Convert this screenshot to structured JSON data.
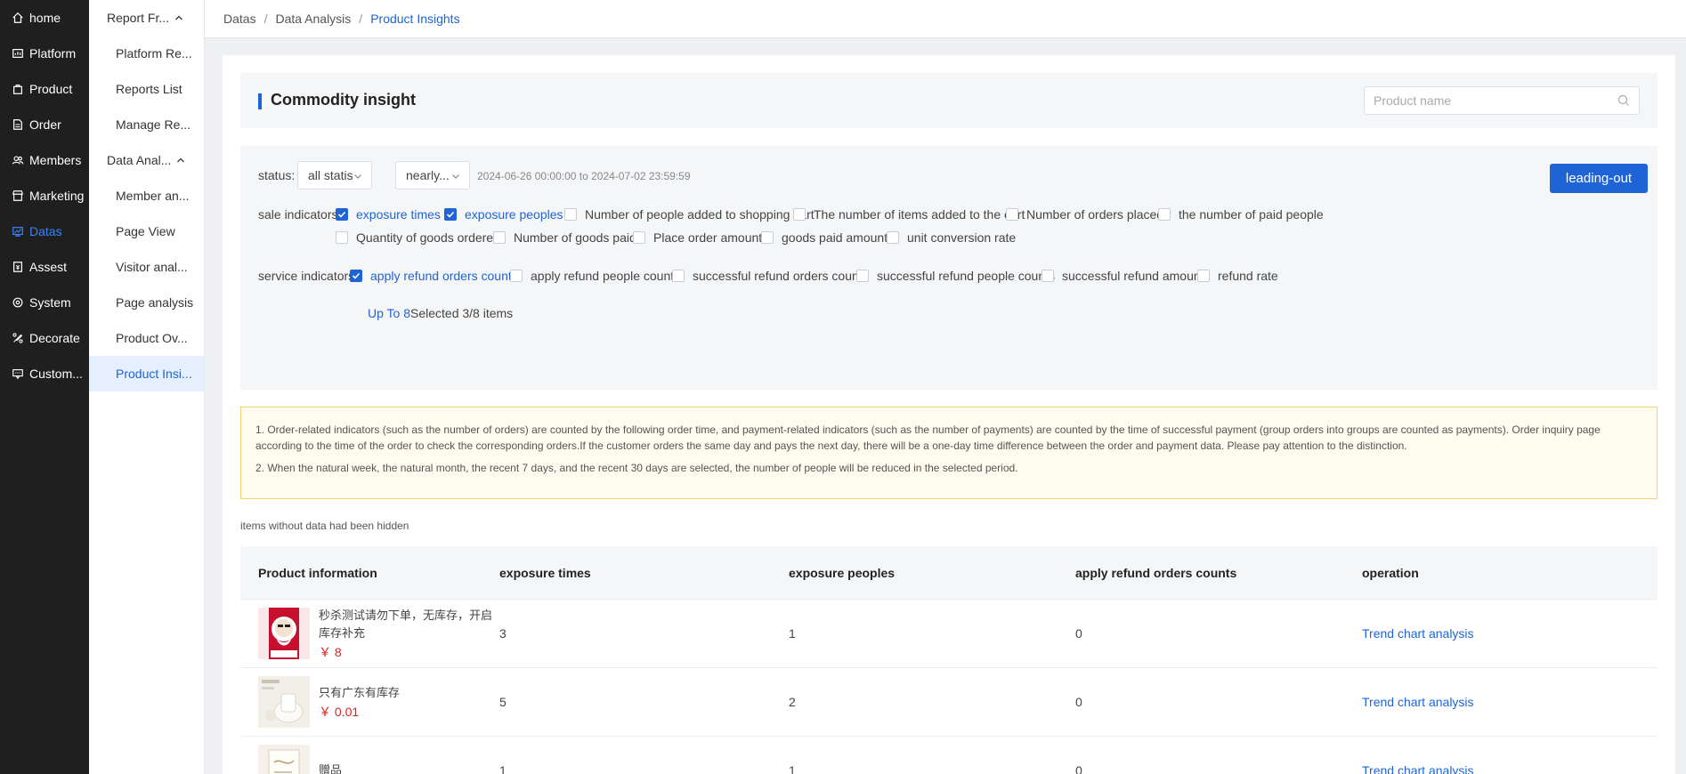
{
  "nav": {
    "items": [
      {
        "label": "home",
        "icon": "home-icon"
      },
      {
        "label": "Platform",
        "icon": "dashboard-icon"
      },
      {
        "label": "Product",
        "icon": "bag-icon"
      },
      {
        "label": "Order",
        "icon": "document-icon"
      },
      {
        "label": "Members",
        "icon": "users-icon"
      },
      {
        "label": "Marketing",
        "icon": "shop-icon"
      },
      {
        "label": "Datas",
        "icon": "chart-icon",
        "active": true
      },
      {
        "label": "Assest",
        "icon": "wallet-icon"
      },
      {
        "label": "System",
        "icon": "gear-icon"
      },
      {
        "label": "Decorate",
        "icon": "brush-icon"
      },
      {
        "label": "Custom...",
        "icon": "service-icon"
      }
    ]
  },
  "subnav": {
    "group1": "Report Fr...",
    "group1_items": [
      "Platform Re...",
      "Reports List",
      "Manage Re..."
    ],
    "group2": "Data Anal...",
    "group2_items": [
      "Member an...",
      "Page View",
      "Visitor anal...",
      "Page analysis",
      "Product Ov...",
      "Product Insi..."
    ]
  },
  "breadcrumb": [
    "Datas",
    "Data Analysis",
    "Product Insights"
  ],
  "header": {
    "title": "Commodity insight",
    "search_placeholder": "Product name"
  },
  "filters": {
    "status_label": "status:",
    "status_value": "all statis",
    "period_value": "nearly...",
    "date_range": "2024-06-26 00:00:00 to 2024-07-02 23:59:59",
    "export_label": "leading-out",
    "sale_label": "sale indicators:",
    "sale_indicators": [
      {
        "label": "exposure times",
        "checked": true
      },
      {
        "label": "exposure peoples",
        "checked": true
      },
      {
        "label": "Number of people added to shopping cart",
        "checked": false
      },
      {
        "label": "The number of items added to the cart",
        "checked": false
      },
      {
        "label": "Number of orders placed",
        "checked": false
      },
      {
        "label": "the number of paid people",
        "checked": false
      },
      {
        "label": "Quantity of goods ordered",
        "checked": false
      },
      {
        "label": "Number of goods paid",
        "checked": false
      },
      {
        "label": "Place order amount",
        "checked": false
      },
      {
        "label": "goods paid amount",
        "checked": false
      },
      {
        "label": "unit conversion rate",
        "checked": false
      }
    ],
    "service_label": "service indicators:",
    "service_indicators": [
      {
        "label": "apply refund orders counts",
        "checked": true
      },
      {
        "label": "apply refund people counts",
        "checked": false
      },
      {
        "label": "successful refund orders counts",
        "checked": false
      },
      {
        "label": "successful refund people counts",
        "checked": false
      },
      {
        "label": "successful refund amount",
        "checked": false
      },
      {
        "label": "refund rate",
        "checked": false
      }
    ],
    "limit_text": "Up To 8",
    "selected_text": "Selected 3/8 items"
  },
  "notice": {
    "line1": "1. Order-related indicators (such as the number of orders) are counted by the following order time, and payment-related indicators (such as the number of payments) are counted by the time of successful payment (group orders into groups are counted as payments). Order inquiry page according to the time of the order to check the corresponding orders.If the customer orders the same day and pays the next day, there will be a one-day time difference between the order and payment data. Please pay attention to the distinction.",
    "line2": "2. When the natural week, the natural month, the recent 7 days, and the recent 30 days are selected, the number of people will be reduced in the selected period."
  },
  "hidden_note": "items without data had been hidden",
  "table": {
    "columns": [
      "Product information",
      "exposure times",
      "exposure peoples",
      "apply refund orders counts",
      "operation"
    ],
    "rows": [
      {
        "name": "秒杀测试请勿下单，无库存，开启库存补充",
        "price": "￥ 8",
        "exposure_times": "3",
        "exposure_peoples": "1",
        "refund_orders": "0",
        "operation": "Trend chart analysis"
      },
      {
        "name": "只有广东有库存",
        "price": "￥ 0.01",
        "exposure_times": "5",
        "exposure_peoples": "2",
        "refund_orders": "0",
        "operation": "Trend chart analysis"
      },
      {
        "name": "赠品",
        "price": "",
        "exposure_times": "1",
        "exposure_peoples": "1",
        "refund_orders": "0",
        "operation": "Trend chart analysis"
      }
    ]
  },
  "colors": {
    "accent": "#1e64d6",
    "sidebar": "#1f1f1f",
    "price": "#e0201b",
    "notice_border": "#f5d173"
  }
}
